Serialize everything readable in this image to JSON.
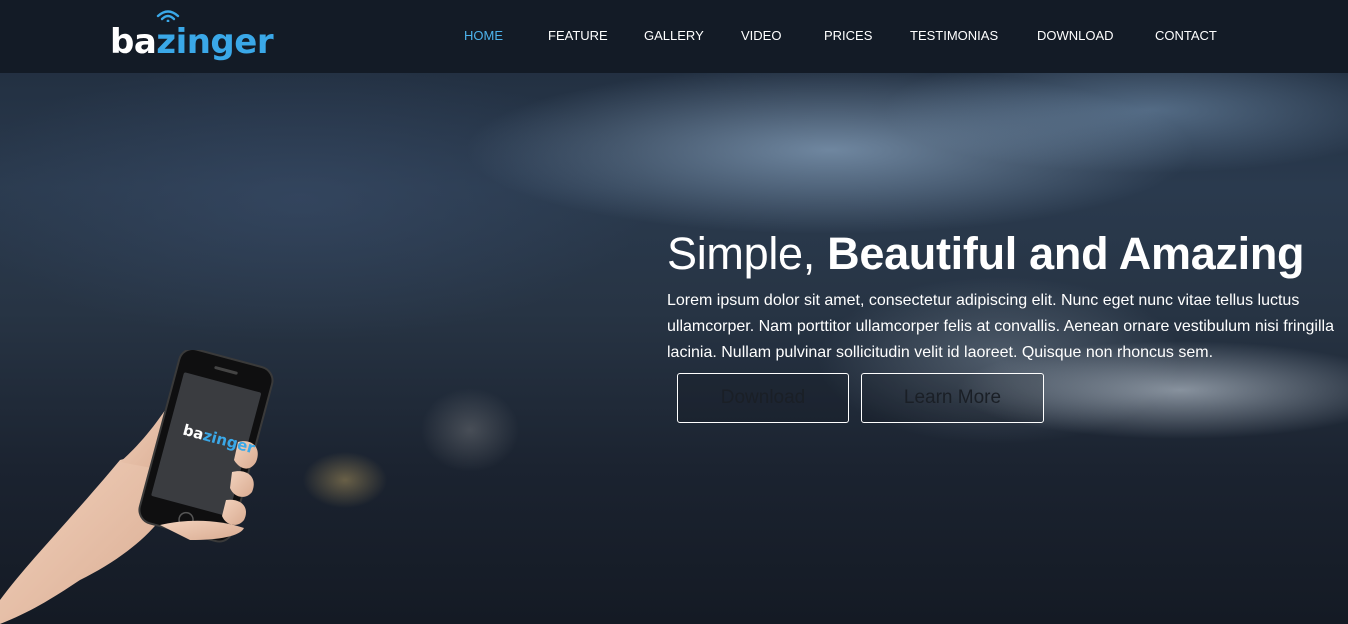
{
  "brand": {
    "logo_part1": "ba",
    "logo_part2": "zinger",
    "logo_color": "#3aa8e8"
  },
  "nav": {
    "items": [
      {
        "label": "HOME",
        "active": true
      },
      {
        "label": "FEATURE",
        "active": false
      },
      {
        "label": "GALLERY",
        "active": false
      },
      {
        "label": "VIDEO",
        "active": false
      },
      {
        "label": "PRICES",
        "active": false
      },
      {
        "label": "TESTIMONIAS",
        "active": false
      },
      {
        "label": "DOWNLOAD",
        "active": false
      },
      {
        "label": "CONTACT",
        "active": false
      }
    ],
    "active_color": "#4db3ec"
  },
  "hero": {
    "title_light": "Simple,",
    "title_bold": "Beautiful and Amazing",
    "description": "Lorem ipsum dolor sit amet, consectetur adipiscing elit. Nunc eget nunc vitae tellus luctus ullamcorper. Nam porttitor ullamcorper felis at convallis. Aenean ornare vestibulum nisi fringilla lacinia. Nullam pulvinar sollicitudin velit id laoreet. Quisque non rhoncus sem.",
    "download_label": "Download",
    "learn_more_label": "Learn More"
  },
  "phone": {
    "screen_logo_part1": "ba",
    "screen_logo_part2": "zinger"
  }
}
